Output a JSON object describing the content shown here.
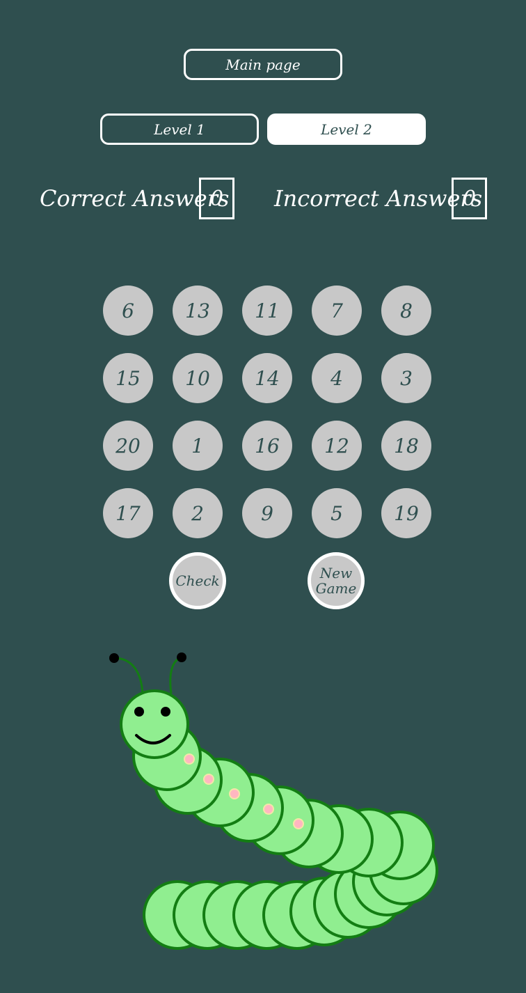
{
  "nav": {
    "main_page": "Main page",
    "level1": "Level 1",
    "level2": "Level 2",
    "active_level": "Level 2"
  },
  "score": {
    "correct_label": "Correct Answers",
    "correct_value": "0",
    "incorrect_label": "Incorrect Answers",
    "incorrect_value": "0"
  },
  "numbers": [
    [
      "6",
      "13",
      "11",
      "7",
      "8"
    ],
    [
      "15",
      "10",
      "14",
      "4",
      "3"
    ],
    [
      "20",
      "1",
      "16",
      "12",
      "18"
    ],
    [
      "17",
      "2",
      "9",
      "5",
      "19"
    ]
  ],
  "actions": {
    "check": "Check",
    "new_game_line1": "New",
    "new_game_line2": "Game"
  },
  "colors": {
    "background": "#2f4f4f",
    "number_circle": "#c8c8c8",
    "caterpillar_body": "#90ee90",
    "caterpillar_outline": "#137d13"
  }
}
